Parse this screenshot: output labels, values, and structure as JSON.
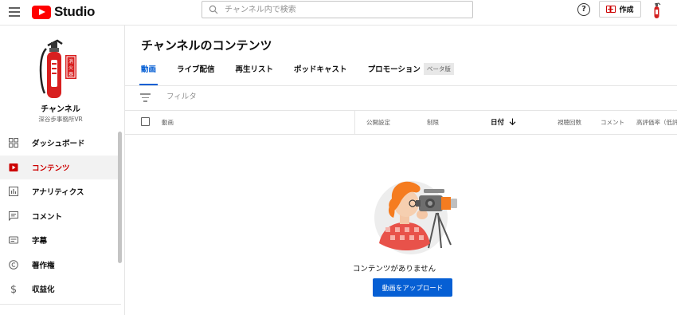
{
  "header": {
    "logo_text": "Studio",
    "search_placeholder": "チャンネル内で検索",
    "help_label": "?",
    "create_label": "作成"
  },
  "sidebar": {
    "channel_name": "チャンネル",
    "channel_subtitle": "深谷歩事務所VR",
    "items": [
      {
        "label": "ダッシュボード",
        "icon": "dashboard-icon"
      },
      {
        "label": "コンテンツ",
        "icon": "content-icon",
        "active": true
      },
      {
        "label": "アナリティクス",
        "icon": "analytics-icon"
      },
      {
        "label": "コメント",
        "icon": "comments-icon"
      },
      {
        "label": "字幕",
        "icon": "subtitles-icon"
      },
      {
        "label": "著作権",
        "icon": "copyright-icon"
      },
      {
        "label": "収益化",
        "icon": "monetization-icon"
      }
    ]
  },
  "main": {
    "title": "チャンネルのコンテンツ",
    "tabs": [
      {
        "label": "動画",
        "active": true
      },
      {
        "label": "ライブ配信"
      },
      {
        "label": "再生リスト"
      },
      {
        "label": "ポッドキャスト"
      },
      {
        "label": "プロモーション",
        "badge": "ベータ版"
      }
    ],
    "filter_placeholder": "フィルタ",
    "columns": {
      "video": "動画",
      "visibility": "公開設定",
      "restrictions": "制限",
      "date": "日付",
      "views": "視聴回数",
      "comments": "コメント",
      "likes": "高評価率（低評"
    },
    "sort_icon": "arrow-down-icon",
    "empty_message": "コンテンツがありません",
    "upload_label": "動画をアップロード"
  },
  "colors": {
    "accent": "#065fd4",
    "active_nav": "#cc0000",
    "brand": "#ff0000"
  }
}
